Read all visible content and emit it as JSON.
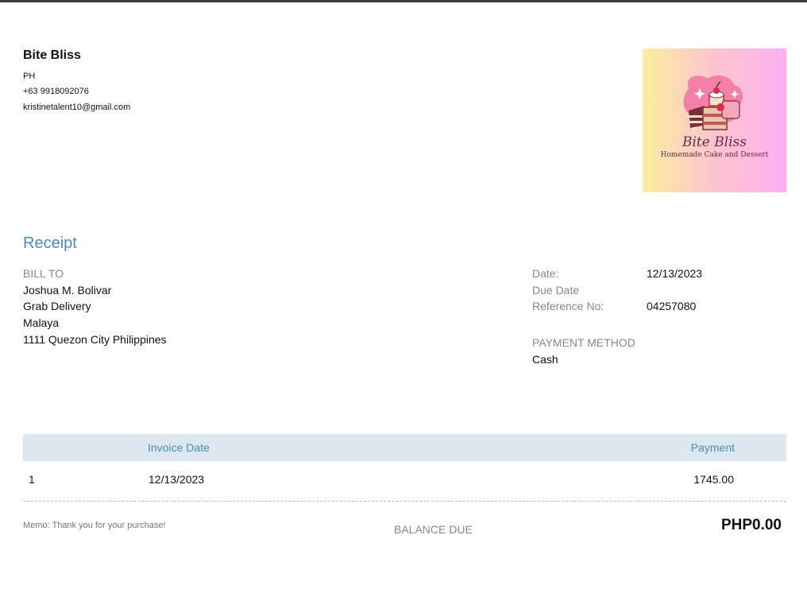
{
  "company": {
    "name": "Bite Bliss",
    "country": "PH",
    "phone": "+63 9918092076",
    "email": "kristinetalent10@gmail.com"
  },
  "logo": {
    "name": "Bite Bliss",
    "tagline": "Homemade Cake and Dessert",
    "icon": "cake-slices-icon"
  },
  "document": {
    "title": "Receipt"
  },
  "bill_to": {
    "label": "BILL TO",
    "lines": [
      "Joshua M. Bolivar",
      "Grab Delivery",
      "Malaya",
      "1111 Quezon City Philippines"
    ]
  },
  "meta": {
    "date_label": "Date:",
    "date_value": "12/13/2023",
    "due_label": "Due Date",
    "due_value": "",
    "ref_label": "Reference No:",
    "ref_value": "04257080",
    "payment_method_label": "PAYMENT METHOD",
    "payment_method_value": "Cash"
  },
  "table": {
    "headers": [
      "",
      "Invoice Date",
      "Payment"
    ],
    "rows": [
      {
        "index": "1",
        "invoice_date": "12/13/2023",
        "payment": "1745.00"
      }
    ]
  },
  "footer": {
    "memo": "Memo: Thank you for your purchase!",
    "balance_label": "BALANCE DUE",
    "balance_value": "PHP0.00"
  },
  "colors": {
    "accent": "#4a8bbd",
    "table_header_bg": "#dde7f0",
    "muted": "#888888"
  }
}
